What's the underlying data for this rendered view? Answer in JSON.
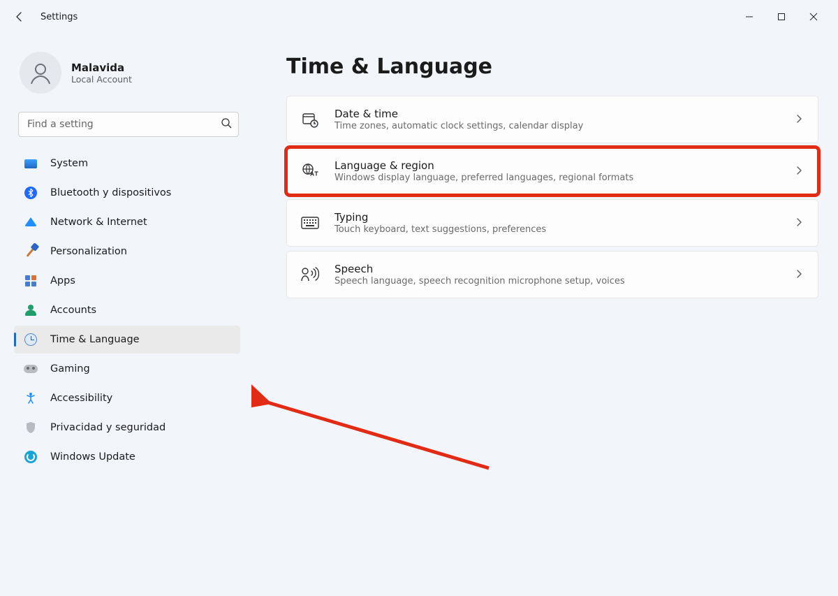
{
  "app": {
    "title": "Settings"
  },
  "user": {
    "name": "Malavida",
    "subtitle": "Local Account"
  },
  "search": {
    "placeholder": "Find a setting"
  },
  "sidebar": {
    "items": [
      {
        "label": "System"
      },
      {
        "label": "Bluetooth y dispositivos"
      },
      {
        "label": "Network & Internet"
      },
      {
        "label": "Personalization"
      },
      {
        "label": "Apps"
      },
      {
        "label": "Accounts"
      },
      {
        "label": "Time & Language"
      },
      {
        "label": "Gaming"
      },
      {
        "label": "Accessibility"
      },
      {
        "label": "Privacidad y seguridad"
      },
      {
        "label": "Windows Update"
      }
    ],
    "selected_index": 6
  },
  "page": {
    "title": "Time & Language"
  },
  "cards": [
    {
      "title": "Date & time",
      "desc": "Time zones, automatic clock settings, calendar display"
    },
    {
      "title": "Language & region",
      "desc": "Windows display language, preferred languages, regional formats"
    },
    {
      "title": "Typing",
      "desc": "Touch keyboard, text suggestions, preferences"
    },
    {
      "title": "Speech",
      "desc": "Speech language, speech recognition microphone setup, voices"
    }
  ],
  "highlighted_card_index": 1
}
